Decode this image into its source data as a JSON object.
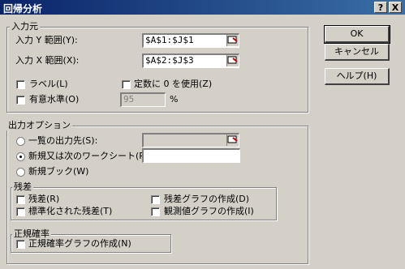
{
  "window": {
    "title": "回帰分析",
    "help_button": "?",
    "close_button": "X"
  },
  "buttons": {
    "ok": "OK",
    "cancel": "キャンセル",
    "help": "ヘルプ(H)"
  },
  "input": {
    "group_label": "入力元",
    "y_range_label": "入力 Y 範囲(Y):",
    "y_range_value": "$A$1:$J$1",
    "x_range_label": "入力 X 範囲(X):",
    "x_range_value": "$A$2:$J$3",
    "labels_label": "ラベル(L)",
    "labels_checked": false,
    "const_zero_label": "定数に 0 を使用(Z)",
    "const_zero_checked": false,
    "confidence_label": "有意水準(O)",
    "confidence_checked": false,
    "confidence_value": "95",
    "confidence_unit": "%"
  },
  "output": {
    "group_label": "出力オプション",
    "output_range_label": "一覧の出力先(S):",
    "output_range_value": "",
    "new_sheet_label": "新規又は次のワークシート(P):",
    "new_sheet_value": "",
    "new_book_label": "新規ブック(W)",
    "selected": "new_sheet"
  },
  "residuals": {
    "group_label": "残差",
    "residuals_label": "残差(R)",
    "standardized_label": "標準化された残差(T)",
    "residual_plots_label": "残差グラフの作成(D)",
    "line_fit_label": "観測値グラフの作成(I)"
  },
  "normal_probability": {
    "group_label": "正規確率",
    "plot_label": "正規確率グラフの作成(N)"
  }
}
